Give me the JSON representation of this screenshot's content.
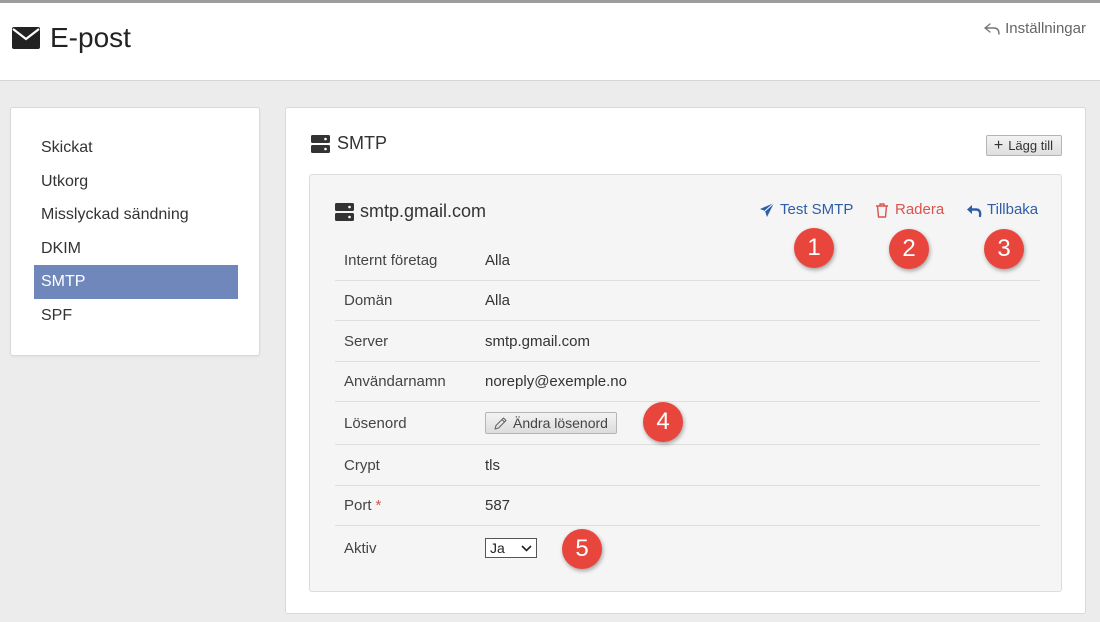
{
  "header": {
    "title": "E-post",
    "settings_label": "Inställningar"
  },
  "sidebar": {
    "items": [
      {
        "label": "Skickat"
      },
      {
        "label": "Utkorg"
      },
      {
        "label": "Misslyckad sändning"
      },
      {
        "label": "DKIM"
      },
      {
        "label": "SMTP",
        "active": true
      },
      {
        "label": "SPF"
      }
    ]
  },
  "panel": {
    "title": "SMTP",
    "add_label": "Lägg till"
  },
  "card": {
    "title": "smtp.gmail.com",
    "actions": {
      "test": "Test SMTP",
      "delete": "Radera",
      "back": "Tillbaka"
    },
    "fields": {
      "company": {
        "label": "Internt företag",
        "value": "Alla"
      },
      "domain": {
        "label": "Domän",
        "value": "Alla"
      },
      "server": {
        "label": "Server",
        "value": "smtp.gmail.com"
      },
      "username": {
        "label": "Användarnamn",
        "value": "noreply@exemple.no"
      },
      "password": {
        "label": "Lösenord",
        "button": "Ändra lösenord"
      },
      "crypt": {
        "label": "Crypt",
        "value": "tls"
      },
      "port": {
        "label": "Port",
        "required_mark": "*",
        "value": "587"
      },
      "active": {
        "label": "Aktiv",
        "value": "Ja"
      }
    }
  },
  "badges": [
    "1",
    "2",
    "3",
    "4",
    "5"
  ],
  "colors": {
    "accent": "#6f87bb",
    "link": "#2f5ea7",
    "danger": "#d9534f",
    "badge": "#e8453c"
  }
}
